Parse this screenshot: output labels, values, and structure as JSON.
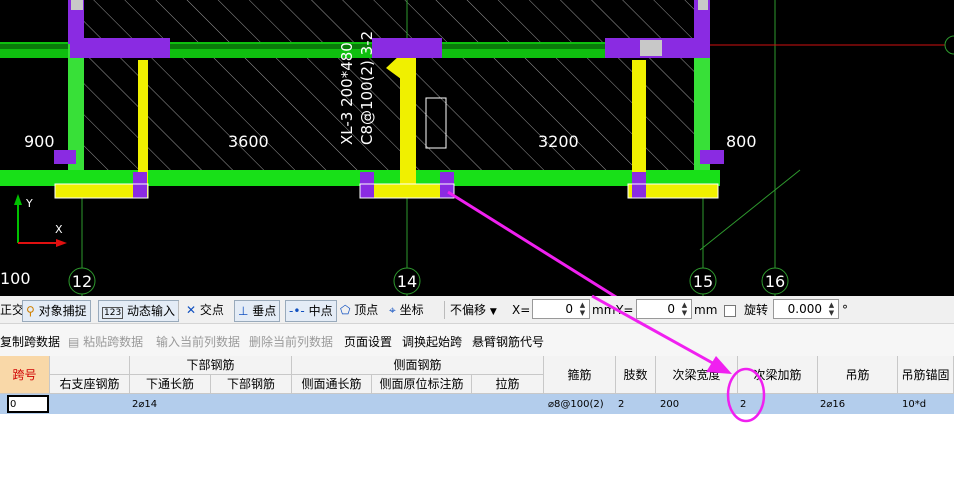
{
  "cad": {
    "dim_900": "900",
    "dim_3600": "3600",
    "dim_3200": "3200",
    "dim_800": "800",
    "beam_label_1": "XL-3 200*480",
    "beam_label_2": "C8@100(2) 3-2",
    "axis_y": "Y",
    "axis_x": "X",
    "left_fragment": "100",
    "grid_12": "12",
    "grid_14": "14",
    "grid_15": "15",
    "grid_16": "16"
  },
  "toolbar1": {
    "ortho": "正交",
    "snap": "对象捕捉",
    "dyn": "动态输入",
    "intersect": "交点",
    "perp": "垂点",
    "mid": "中点",
    "vertex": "顶点",
    "coord": "坐标",
    "offset": "不偏移",
    "x_label": "X=",
    "x_value": "0",
    "mm1": "mm",
    "y_label": "Y=",
    "y_value": "0",
    "mm2": "mm",
    "rotate": "旋转",
    "rotate_value": "0.000",
    "deg": "°"
  },
  "toolbar2": {
    "copy": "复制跨数据",
    "paste": "粘贴跨数据",
    "input_col": "输入当前列数据",
    "delete_col": "删除当前列数据",
    "page_setup": "页面设置",
    "swap_start": "调换起始跨",
    "cantilever": "悬臂钢筋代号"
  },
  "table": {
    "h_span": "跨号",
    "h_bottom_group": "下部钢筋",
    "h_side_group": "侧面钢筋",
    "h_right_support": "右支座钢筋",
    "h_bottom_through": "下通长筋",
    "h_bottom_rebar": "下部钢筋",
    "h_side_through": "侧面通长筋",
    "h_side_original": "侧面原位标注筋",
    "h_tie": "拉筋",
    "h_stirrup": "箍筋",
    "h_legs": "肢数",
    "h_secondary_width": "次梁宽度",
    "h_secondary_add": "次梁加筋",
    "h_hanger": "吊筋",
    "h_hanger_anchor": "吊筋锚固",
    "row": {
      "span": "0",
      "bottom_through": "2⌀14",
      "stirrup": "⌀8@100(2)",
      "legs": "2",
      "secondary_width": "200",
      "secondary_add": "2",
      "hanger": "2⌀16",
      "hanger_anchor": "10*d"
    }
  }
}
